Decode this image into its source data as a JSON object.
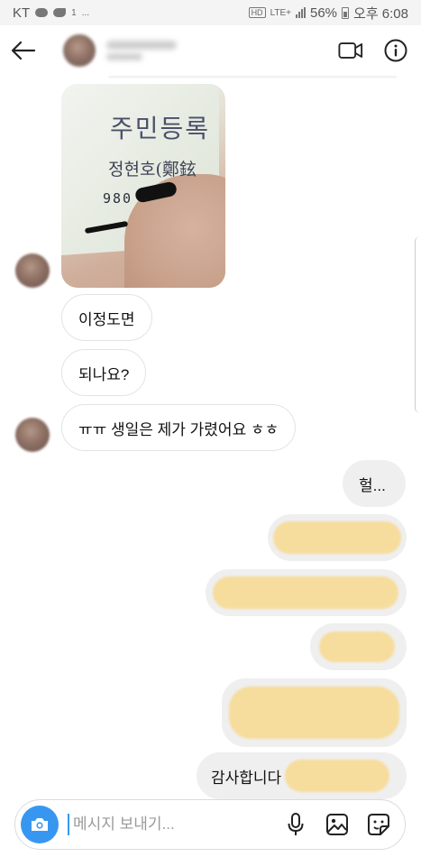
{
  "status_bar": {
    "carrier": "KT",
    "mini_icon_text": "1",
    "dots": "...",
    "hd": "HD",
    "network": "LTE+",
    "battery": "56%",
    "time": "오후 6:08"
  },
  "header": {
    "name": "",
    "subtitle": ""
  },
  "messages": [
    {
      "from": "them",
      "kind": "image",
      "image_text": [
        "주민등록",
        "정현호(鄭鉉",
        "980"
      ]
    },
    {
      "from": "them",
      "kind": "text",
      "text": "이정도면"
    },
    {
      "from": "them",
      "kind": "text",
      "text": "되나요?"
    },
    {
      "from": "them",
      "kind": "text",
      "text": "ㅠㅠ 생일은 제가 가렸어요 ㅎㅎ"
    },
    {
      "from": "me",
      "kind": "text",
      "text": "헐..."
    },
    {
      "from": "me",
      "kind": "redacted"
    },
    {
      "from": "me",
      "kind": "redacted"
    },
    {
      "from": "me",
      "kind": "redacted"
    },
    {
      "from": "me",
      "kind": "redacted"
    },
    {
      "from": "me",
      "kind": "text",
      "text": "감사합니다",
      "partially_redacted": true
    }
  ],
  "composer": {
    "placeholder": "메시지 보내기..."
  },
  "colors": {
    "accent": "#3797f0",
    "incoming_bubble": "#ffffff",
    "outgoing_bubble": "#efefef",
    "redaction": "#f6dd9d"
  },
  "icons": [
    "back-arrow-icon",
    "video-call-icon",
    "info-icon",
    "camera-icon",
    "microphone-icon",
    "gallery-icon",
    "sticker-icon"
  ]
}
